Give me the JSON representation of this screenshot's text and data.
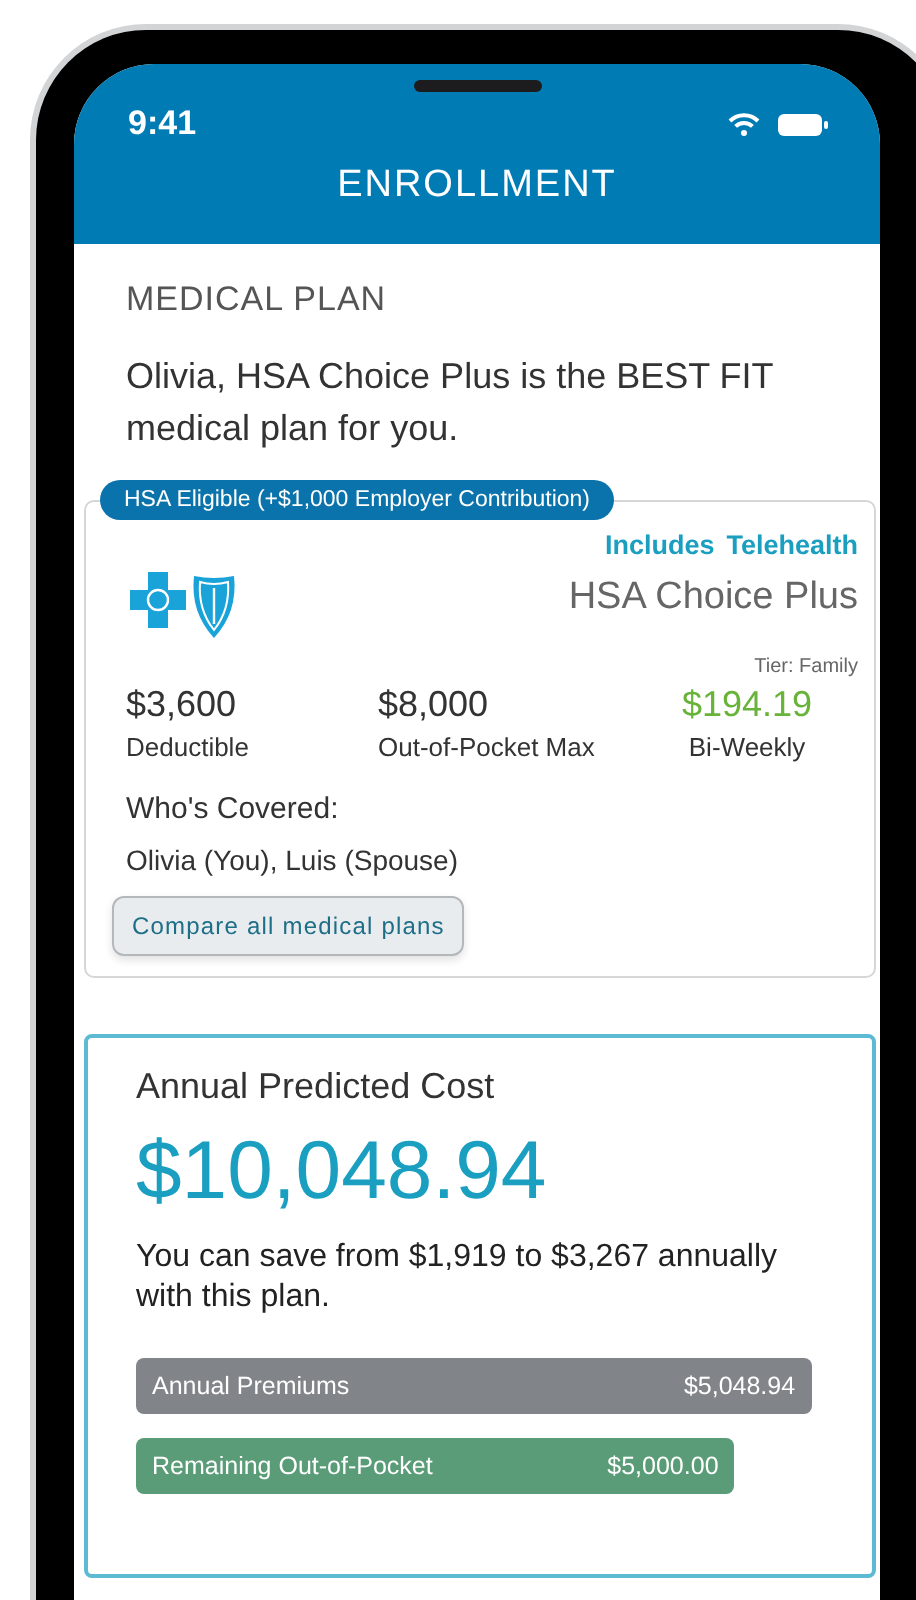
{
  "status_bar": {
    "time": "9:41"
  },
  "header": {
    "title": "ENROLLMENT"
  },
  "section_title": "MEDICAL PLAN",
  "recommendation": "Olivia, HSA Choice Plus is the BEST FIT medical plan for you.",
  "plan_card": {
    "badge": "HSA Eligible (+$1,000 Employer Contribution)",
    "feature_tags": [
      "Includes",
      "Telehealth"
    ],
    "plan_name": "HSA Choice Plus",
    "tier": "Tier: Family",
    "stats": [
      {
        "value": "$3,600",
        "label": "Deductible",
        "kind": "plain"
      },
      {
        "value": "$8,000",
        "label": "Out-of-Pocket Max",
        "kind": "plain"
      },
      {
        "value": "$194.19",
        "label": "Bi-Weekly",
        "kind": "price"
      }
    ],
    "covered_label": "Who's Covered:",
    "covered_people": "Olivia (You), Luis (Spouse)",
    "compare_button": "Compare all medical plans"
  },
  "cost_card": {
    "title": "Annual Predicted Cost",
    "total": "$10,048.94",
    "savings_text": "You can save from $1,919 to $3,267 annually with this plan.",
    "bars": [
      {
        "label": "Annual Premiums",
        "amount": "$5,048.94",
        "color": "#818488"
      },
      {
        "label": "Remaining Out-of-Pocket",
        "amount": "$5,000.00",
        "color": "#5a9c77"
      }
    ]
  }
}
